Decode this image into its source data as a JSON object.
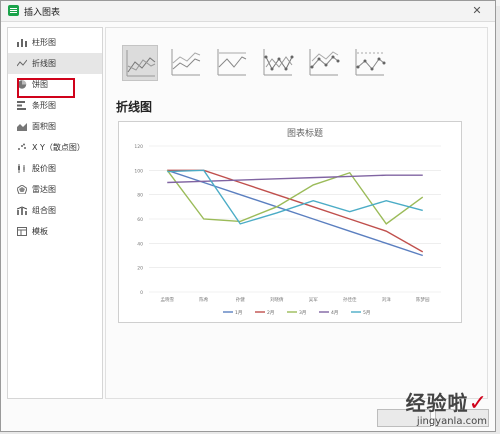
{
  "window": {
    "title": "插入图表",
    "close_icon": "close-icon"
  },
  "nav": {
    "items": [
      {
        "label": "柱形图",
        "icon": "bar-chart-icon"
      },
      {
        "label": "折线图",
        "icon": "line-chart-icon",
        "selected": true
      },
      {
        "label": "饼图",
        "icon": "pie-chart-icon"
      },
      {
        "label": "条形图",
        "icon": "hbar-chart-icon"
      },
      {
        "label": "面积图",
        "icon": "area-chart-icon"
      },
      {
        "label": "X Y（散点图）",
        "icon": "scatter-chart-icon"
      },
      {
        "label": "股价图",
        "icon": "stock-chart-icon"
      },
      {
        "label": "雷达图",
        "icon": "radar-chart-icon"
      },
      {
        "label": "组合图",
        "icon": "combo-chart-icon"
      },
      {
        "label": "模板",
        "icon": "template-icon"
      }
    ]
  },
  "subtypes": {
    "icons": [
      "line-icon",
      "stacked-line-icon",
      "percent-line-icon",
      "line-markers-icon",
      "stacked-line-markers-icon",
      "percent-line-markers-icon"
    ],
    "selected_index": 0
  },
  "section_title": "折线图",
  "chart_data": {
    "type": "line",
    "title": "图表标题",
    "categories": [
      "孟晓雪",
      "陈希",
      "孙健",
      "刘晓倩",
      "吴军",
      "孙佳佳",
      "刘洋",
      "陈梦园"
    ],
    "ylim": [
      0,
      120
    ],
    "yticks": [
      0,
      20,
      40,
      60,
      80,
      100,
      120
    ],
    "grid": true,
    "legend_position": "bottom",
    "series": [
      {
        "name": "1月",
        "color": "#5b7fc0",
        "values": [
          100,
          90,
          80,
          70,
          60,
          50,
          40,
          30
        ]
      },
      {
        "name": "2月",
        "color": "#c0504d",
        "values": [
          100,
          100,
          90,
          80,
          70,
          60,
          50,
          33
        ]
      },
      {
        "name": "3月",
        "color": "#9bbb59",
        "values": [
          100,
          60,
          58,
          70,
          88,
          98,
          56,
          78
        ]
      },
      {
        "name": "4月",
        "color": "#8064a2",
        "values": [
          90,
          91,
          92,
          93,
          94,
          95,
          96,
          96
        ]
      },
      {
        "name": "5月",
        "color": "#4bacc6",
        "values": [
          99,
          100,
          56,
          65,
          75,
          66,
          75,
          67
        ]
      }
    ]
  },
  "watermark": {
    "line1": "经验啦",
    "line2": "jingyanla.com",
    "check": "✓"
  }
}
